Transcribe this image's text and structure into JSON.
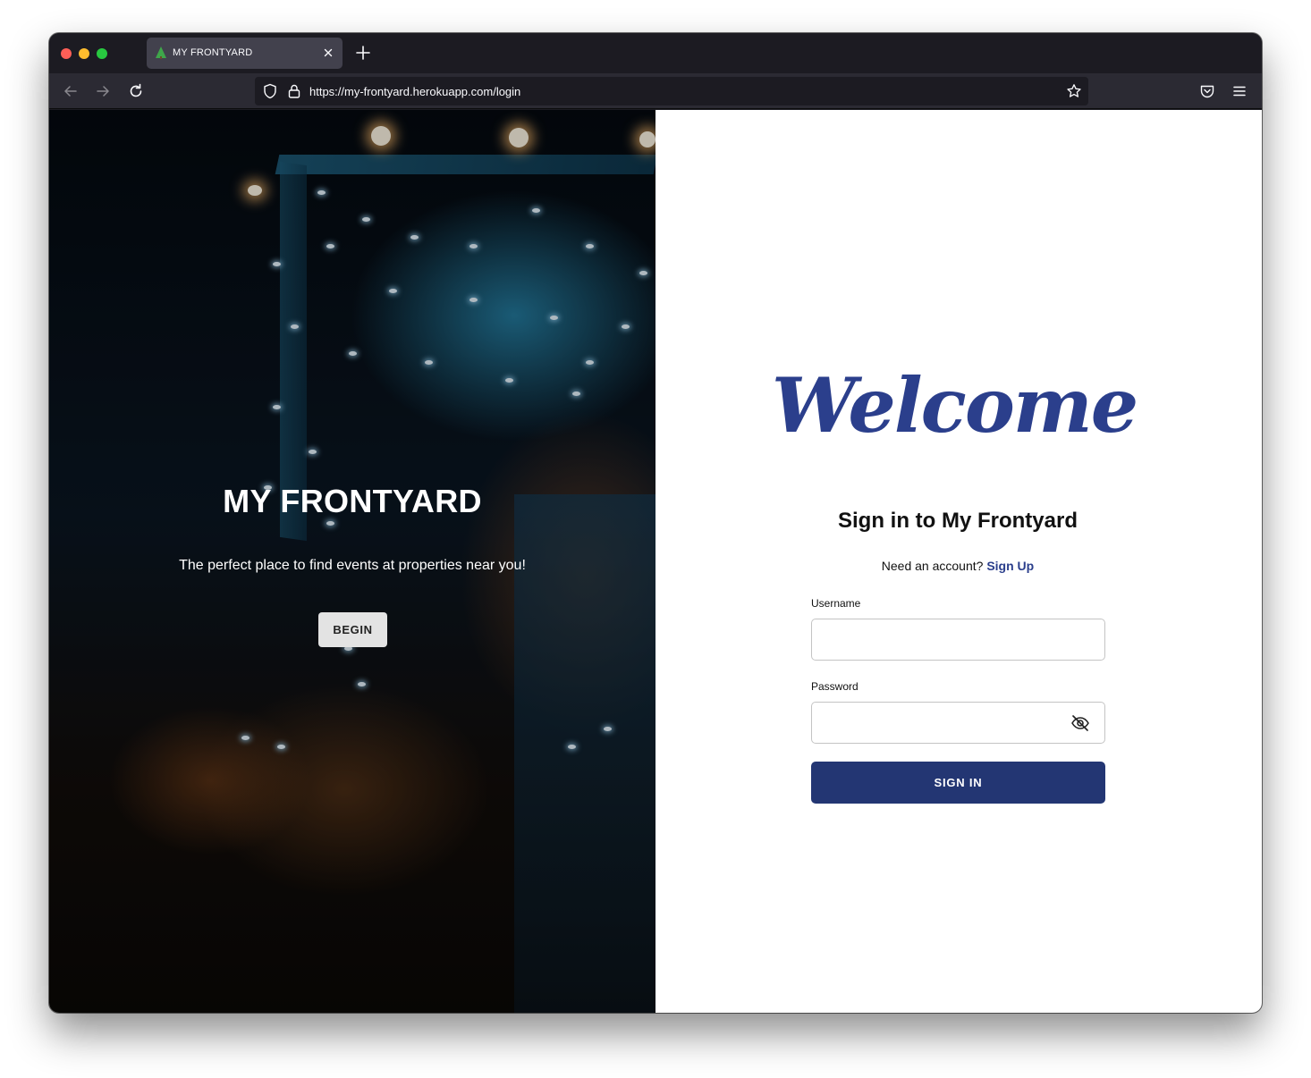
{
  "browser": {
    "tab": {
      "title": "MY FRONTYARD",
      "favicon": "tree-icon"
    },
    "url": "https://my-frontyard.herokuapp.com/login",
    "icons": [
      "back-arrow-icon",
      "forward-arrow-icon",
      "reload-icon",
      "shield-icon",
      "lock-icon",
      "star-icon",
      "pocket-icon",
      "hamburger-menu-icon",
      "close-icon",
      "plus-icon"
    ]
  },
  "hero": {
    "title": "MY FRONTYARD",
    "subtitle": "The perfect place to find events at properties near you!",
    "begin_label": "BEGIN"
  },
  "login": {
    "welcome": "Welcome",
    "title": "Sign in to My Frontyard",
    "need_account": "Need an account?",
    "signup_label": "Sign Up",
    "username_label": "Username",
    "username_value": "",
    "password_label": "Password",
    "password_value": "",
    "signin_label": "SIGN IN"
  },
  "colors": {
    "brand": "#2b3f8c",
    "button": "#233673",
    "chrome_dark": "#1c1b22",
    "chrome_nav": "#2b2a33"
  }
}
